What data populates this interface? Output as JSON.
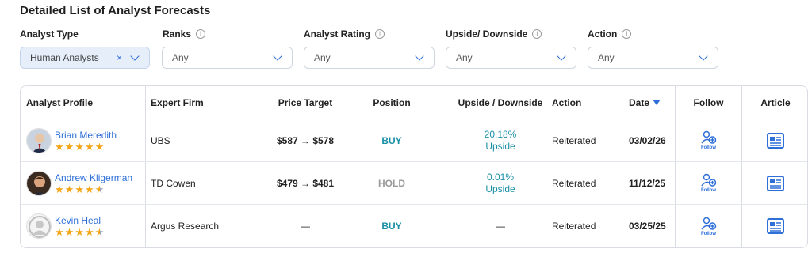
{
  "page": {
    "title": "Detailed List of Analyst Forecasts"
  },
  "filters": {
    "analyst_type": {
      "label": "Analyst Type",
      "value": "Human Analysts",
      "clear": "×"
    },
    "ranks": {
      "label": "Ranks",
      "value": "Any"
    },
    "analyst_rating": {
      "label": "Analyst Rating",
      "value": "Any"
    },
    "upside_downside": {
      "label": "Upside/ Downside",
      "value": "Any"
    },
    "action": {
      "label": "Action",
      "value": "Any"
    },
    "info_glyph": "i"
  },
  "table": {
    "headers": {
      "profile": "Analyst Profile",
      "firm": "Expert Firm",
      "price_target": "Price Target",
      "position": "Position",
      "upside": "Upside / Downside",
      "action": "Action",
      "date": "Date",
      "follow": "Follow",
      "article": "Article"
    },
    "sort": {
      "column": "date",
      "direction": "descending"
    },
    "rows": [
      {
        "name": "Brian Meredith",
        "rating_stars": 5,
        "firm": "UBS",
        "price_target": "$587 → $578",
        "position": "BUY",
        "upside_pct": "20.18%",
        "upside_label": "Upside",
        "action": "Reiterated",
        "date": "03/02/26",
        "follow_label": "Follow"
      },
      {
        "name": "Andrew Kligerman",
        "rating_stars": 4.5,
        "firm": "TD Cowen",
        "price_target": "$479 → $481",
        "position": "HOLD",
        "upside_pct": "0.01%",
        "upside_label": "Upside",
        "action": "Reiterated",
        "date": "11/12/25",
        "follow_label": "Follow"
      },
      {
        "name": "Kevin Heal",
        "rating_stars": 4.5,
        "firm": "Argus Research",
        "price_target": "—",
        "position": "BUY",
        "upside_text": "—",
        "action": "Reiterated",
        "date": "03/25/25",
        "follow_label": "Follow"
      }
    ]
  },
  "colors": {
    "accent": "#2e6fd8",
    "buy": "#1a8fa6",
    "hold": "#9a9a9a",
    "star": "#f2a516"
  },
  "icons": {
    "sort": "triangle-down-icon",
    "follow": "follow-person-plus-icon",
    "article": "newspaper-icon",
    "info": "info-circle-icon",
    "chevron": "chevron-down-icon"
  }
}
